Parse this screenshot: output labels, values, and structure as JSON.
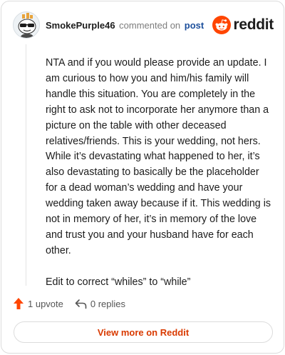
{
  "header": {
    "username": "SmokePurple46",
    "action_text": "commented on",
    "post_link": "post",
    "brand": "reddit"
  },
  "comment": {
    "paragraphs": [
      "NTA and if you would please provide an update. I am curious to how you and him/his family will handle this situation. You are completely in the right to ask not to incorporate her anymore than a picture on the table with other deceased relatives/friends. This is your wedding, not hers. While it’s devastating what happened to her, it’s also devastating to basically be the placeholder for a dead woman’s wedding and have your wedding taken away because if it. This wedding is not in memory of her, it’s in memory of the love and trust you and your husband have for each other.",
      "Edit to correct “whiles” to “while”"
    ]
  },
  "footer": {
    "upvotes": "1 upvote",
    "replies": "0 replies"
  },
  "view_more": "View more on Reddit",
  "colors": {
    "brand_orange": "#ff4500",
    "upvote_orange": "#ff4500",
    "link_blue": "#1c4f9c",
    "view_more_text": "#d93a00"
  },
  "icons": {
    "avatar": "snoo-avatar-with-sunglasses",
    "brand": "reddit-snoo-logo",
    "upvote": "upvote-arrow-icon",
    "reply": "reply-arrow-icon"
  }
}
